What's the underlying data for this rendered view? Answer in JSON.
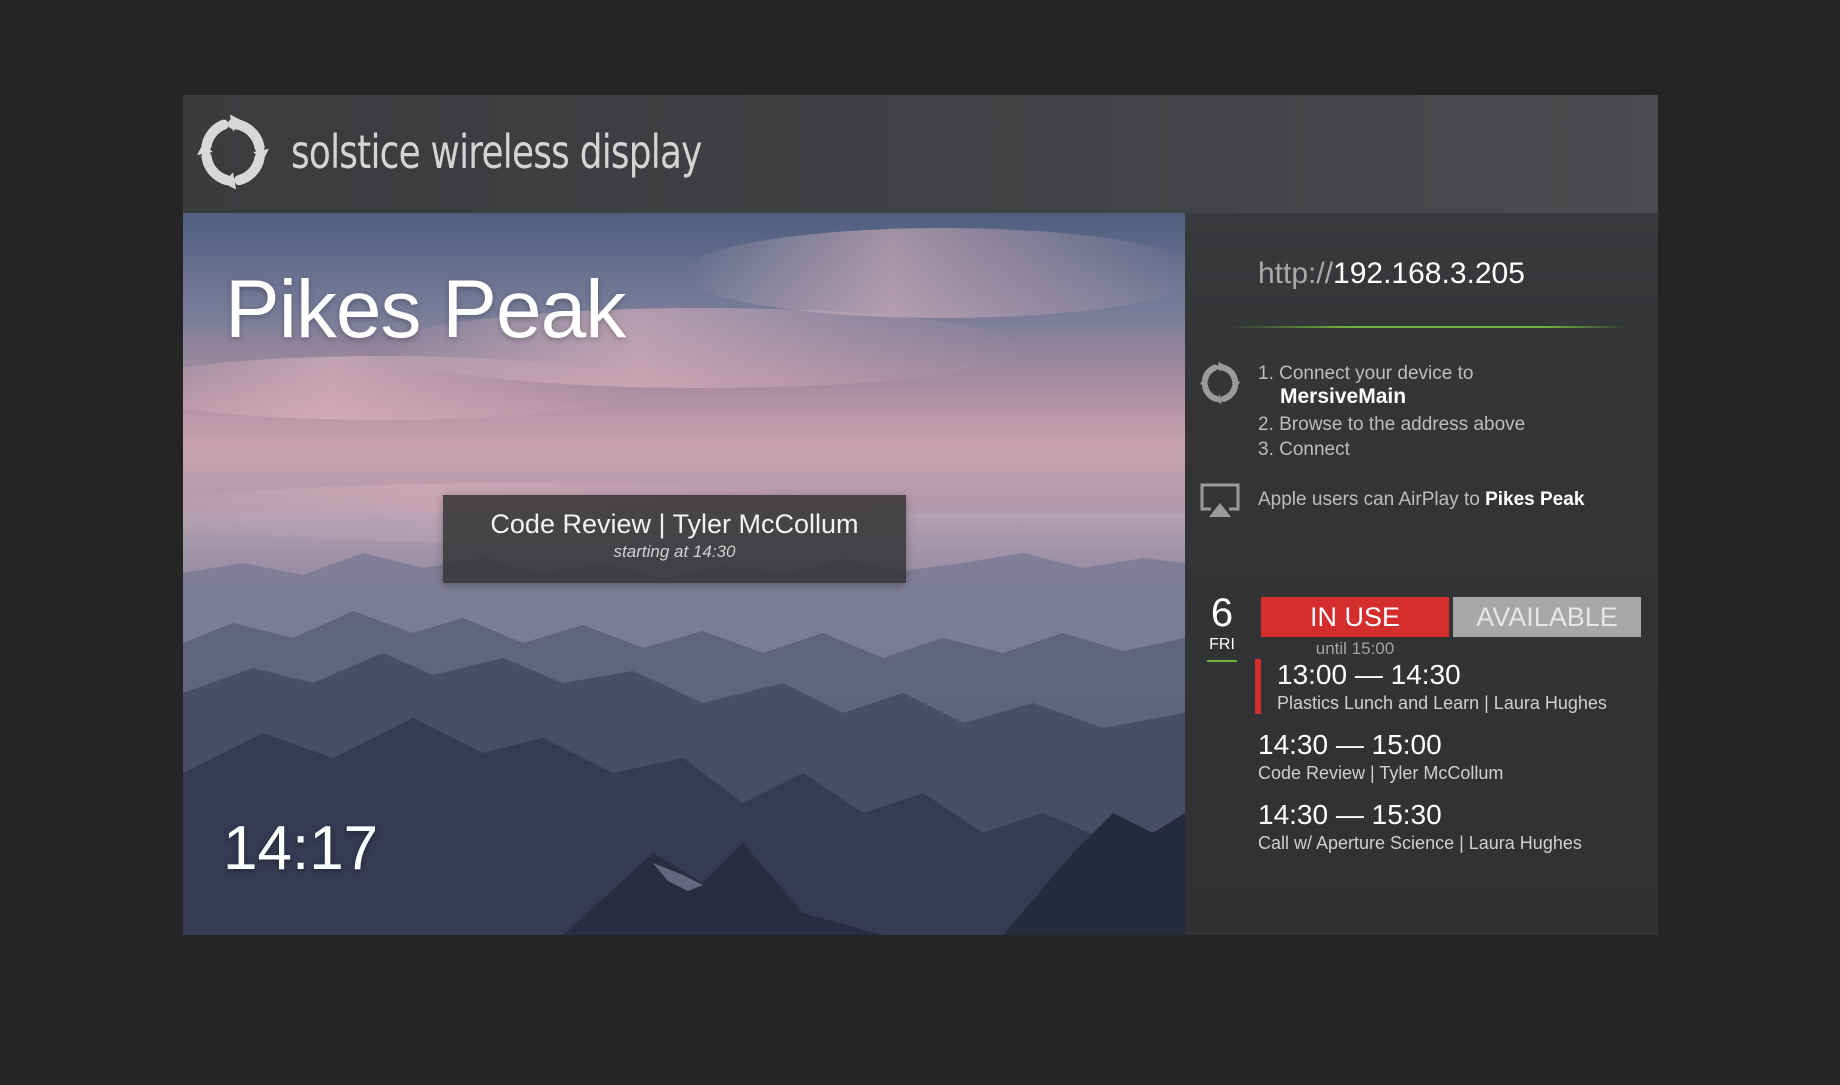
{
  "header": {
    "brand": "solstice wireless display",
    "logo_icon": "solstice-swirl-icon"
  },
  "hero": {
    "room_name": "Pikes Peak",
    "clock": "14:17",
    "next_meeting": {
      "title": "Code Review | Tyler McCollum",
      "subtitle": "starting at 14:30"
    }
  },
  "side": {
    "url_protocol": "http://",
    "url_address": "192.168.3.205",
    "steps": {
      "icon": "solstice-swirl-icon",
      "step1": "1. Connect your device to",
      "network_name": "MersiveMain",
      "step2": "2. Browse to the address above",
      "step3": "3. Connect"
    },
    "airplay": {
      "icon": "airplay-icon",
      "prefix": "Apple users can AirPlay to ",
      "target": "Pikes Peak"
    },
    "date": {
      "day_number": "6",
      "weekday": "FRI"
    },
    "status": {
      "in_use_label": "IN USE",
      "available_label": "AVAILABLE",
      "until": "until 15:00"
    },
    "events": [
      {
        "time": "13:00 — 14:30",
        "title": "Plastics Lunch and Learn | Laura Hughes",
        "current": true
      },
      {
        "time": "14:30 — 15:00",
        "title": "Code Review | Tyler McCollum",
        "current": false
      },
      {
        "time": "14:30 — 15:30",
        "title": "Call w/ Aperture Science | Laura Hughes",
        "current": false
      }
    ]
  },
  "colors": {
    "in_use": "#d42d2d",
    "available": "#a7a7a7",
    "accent_green": "#6fb33d",
    "background": "#252525"
  }
}
